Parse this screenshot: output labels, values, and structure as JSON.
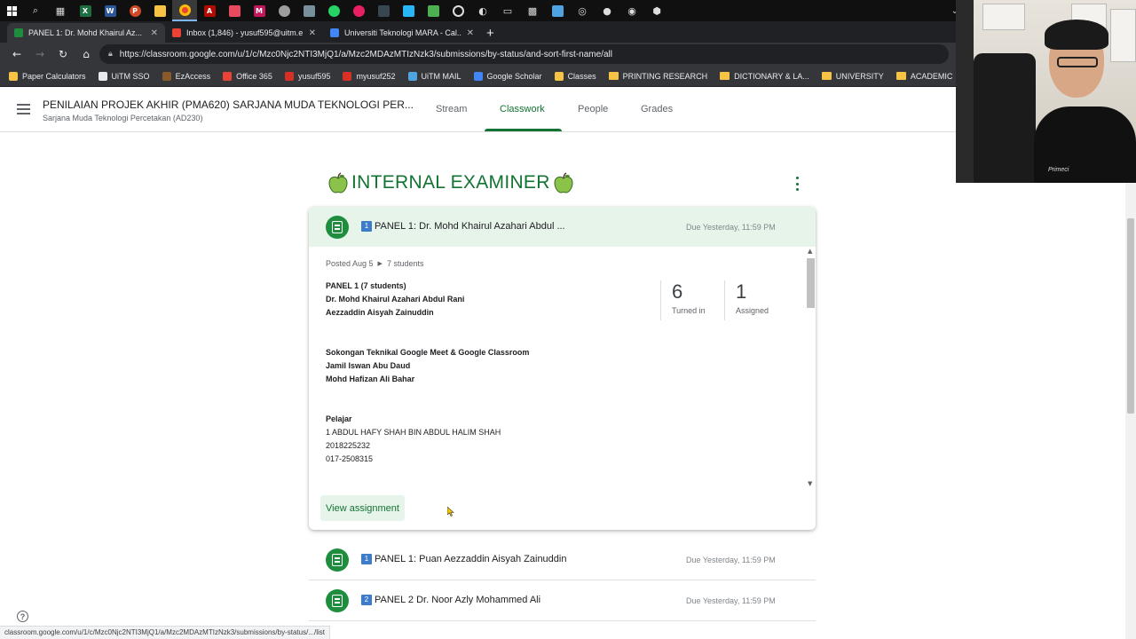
{
  "tabs": [
    {
      "title": "PANEL 1: Dr. Mohd Khairul Az...",
      "favicon_color": "#1e8e3e",
      "active": true
    },
    {
      "title": "Inbox (1,846) - yusuf595@uitm.e...",
      "favicon_color": "#ea4335",
      "active": false
    },
    {
      "title": "Universiti Teknologi MARA - Cal...",
      "favicon_color": "#4285f4",
      "active": false
    }
  ],
  "address": {
    "url": "https://classroom.google.com/u/1/c/Mzc0Njc2NTI3MjQ1/a/Mzc2MDAzMTIzNzk3/submissions/by-status/and-sort-first-name/all"
  },
  "bookmarks": [
    {
      "label": "Paper Calculators",
      "color": "#f6c344",
      "type": "icon"
    },
    {
      "label": "UiTM SSO",
      "color": "#e8eaed",
      "type": "icon"
    },
    {
      "label": "EzAccess",
      "color": "#8b5a2b",
      "type": "icon"
    },
    {
      "label": "Office 365",
      "color": "#ea4335",
      "type": "icon"
    },
    {
      "label": "yusuf595",
      "color": "#d93025",
      "type": "icon"
    },
    {
      "label": "myusuf252",
      "color": "#d93025",
      "type": "icon"
    },
    {
      "label": "UiTM MAIL",
      "color": "#4fa3e0",
      "type": "icon"
    },
    {
      "label": "Google Scholar",
      "color": "#4285f4",
      "type": "icon"
    },
    {
      "label": "Classes",
      "color": "#f6c344",
      "type": "icon"
    },
    {
      "label": "PRINTING RESEARCH",
      "type": "folder"
    },
    {
      "label": "DICTIONARY & LA...",
      "type": "folder"
    },
    {
      "label": "UNIVERSITY",
      "type": "folder"
    },
    {
      "label": "ACADEMIC",
      "type": "folder"
    }
  ],
  "header": {
    "class_title": "PENILAIAN PROJEK AKHIR (PMA620) SARJANA MUDA TEKNOLOGI PER...",
    "class_subtitle": "Sarjana Muda Teknologi Percetakan (AD230)",
    "nav": [
      "Stream",
      "Classwork",
      "People",
      "Grades"
    ],
    "active_nav": "Classwork"
  },
  "topic": {
    "title": "INTERNAL EXAMINER"
  },
  "expanded": {
    "badge": "1",
    "title": "PANEL 1: Dr. Mohd Khairul Azahari Abdul ...",
    "due": "Due Yesterday, 11:59 PM",
    "posted": "Posted Aug 5",
    "students": "7 students",
    "desc_bold_1": "PANEL 1 (7 students)\nDr. Mohd Khairul Azahari Abdul Rani\nAezzaddin Aisyah Zainuddin",
    "desc_bold_2": "Sokongan Teknikal Google Meet & Google Classroom\nJamil Iswan Abu Daud\nMohd Hafizan Ali Bahar",
    "desc_bold_3": "Pelajar",
    "desc_plain": "1 ABDUL HAFY SHAH BIN ABDUL HALIM SHAH\n2018225232\n017-2508315",
    "turned_in": "6",
    "turned_in_label": "Turned in",
    "assigned": "1",
    "assigned_label": "Assigned",
    "view_button": "View assignment"
  },
  "rows": [
    {
      "badge": "1",
      "title": "PANEL 1: Puan Aezzaddin Aisyah Zainuddin",
      "due": "Due Yesterday, 11:59 PM"
    },
    {
      "badge": "2",
      "title": "PANEL 2 Dr. Noor Azly Mohammed Ali",
      "due": "Due Yesterday, 11:59 PM"
    }
  ],
  "statusbar": {
    "text": "classroom.google.com/u/1/c/Mzc0Njc2NTI3MjQ1/a/Mzc2MDAzMTIzNzk3/submissions/by-status/.../list"
  },
  "webcam": {
    "shirt_logo": "Primeci"
  },
  "colors": {
    "accent": "#137333",
    "chip": "#e6f4ea",
    "icon_green": "#1e8e3e",
    "badge_blue": "#3d7cc9"
  }
}
